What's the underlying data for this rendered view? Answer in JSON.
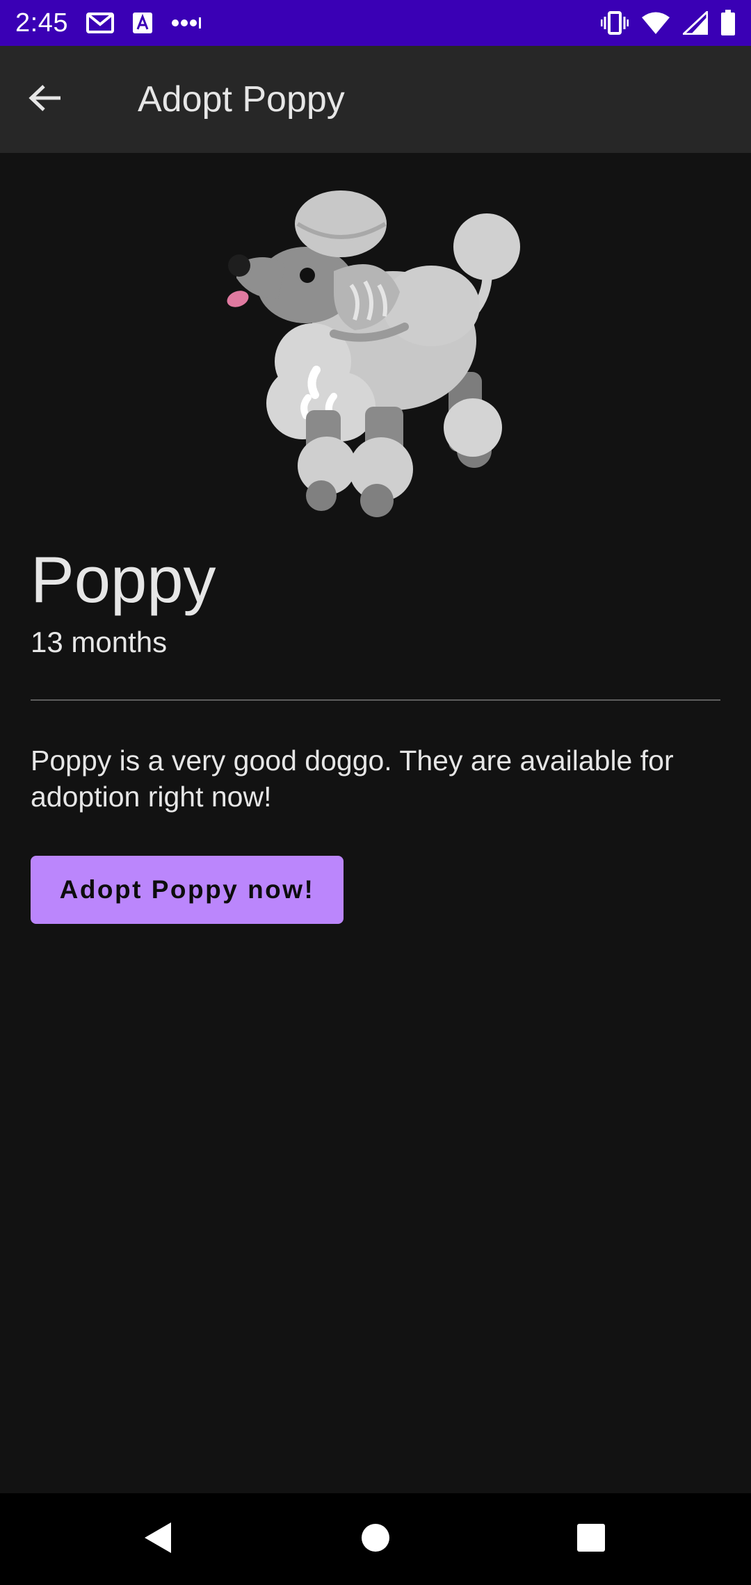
{
  "status_bar": {
    "time": "2:45",
    "left_icons": [
      "gmail-icon",
      "text-a-icon",
      "more-dots-icon"
    ],
    "right_icons": [
      "vibrate-icon",
      "wifi-icon",
      "signal-icon",
      "battery-icon"
    ],
    "background": "#3a00b5"
  },
  "app_bar": {
    "back_icon": "arrow-back-icon",
    "title": "Adopt Poppy"
  },
  "pet": {
    "image_icon": "poodle-illustration",
    "name": "Poppy",
    "age": "13 months",
    "description": "Poppy is a very good doggo. They are available for adoption right now!",
    "adopt_label": "Adopt Poppy now!"
  },
  "nav_bar": {
    "buttons": [
      "back-triangle-icon",
      "home-circle-icon",
      "recents-square-icon"
    ]
  },
  "colors": {
    "background": "#121212",
    "app_bar": "#272727",
    "accent": "#bb86fc",
    "text": "#e6e6e6"
  }
}
